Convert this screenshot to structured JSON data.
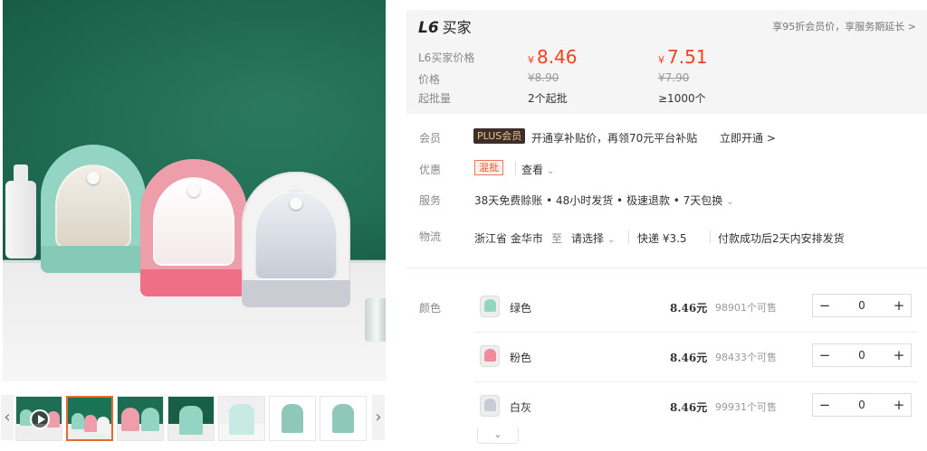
{
  "gallery": {
    "prev_arrow": "‹",
    "next_arrow": "›",
    "thumbnails": [
      {
        "kind": "video",
        "active": false
      },
      {
        "kind": "image",
        "active": true
      },
      {
        "kind": "image",
        "active": false
      },
      {
        "kind": "image",
        "active": false
      },
      {
        "kind": "image",
        "active": false
      },
      {
        "kind": "image",
        "active": false
      },
      {
        "kind": "image",
        "active": false
      }
    ]
  },
  "price_panel": {
    "tier_badge": "L6",
    "tier_title": "买家",
    "member_note": "享95折会员价，享服务期延长 > ",
    "price_label": "L6买家价格",
    "orig_label": "价格",
    "moq_label": "起批量",
    "currency": "¥",
    "tiers": [
      {
        "price": "8.46",
        "orig": "¥8.90",
        "moq": "2个起批"
      },
      {
        "price": "7.51",
        "orig": "¥7.90",
        "moq": "≥1000个"
      }
    ],
    "colors": {
      "price": "#ff3f1a",
      "panel_bg": "#f5f5f5"
    }
  },
  "member": {
    "label": "会员",
    "badge": "PLUS会员",
    "text": "开通享补贴价，再领70元平台补贴",
    "action": "立即开通 >"
  },
  "promo": {
    "label": "优惠",
    "tag": "混批",
    "action": "查看"
  },
  "service": {
    "label": "服务",
    "text": "38天免费赊账 • 48小时发货 • 极速退款 • 7天包换"
  },
  "logistics": {
    "label": "物流",
    "origin": "浙江省 金华市",
    "to": "至",
    "dest_select": "请选择",
    "shipping": "快递 ¥3.5",
    "dispatch": "付款成功后2天内安排发货"
  },
  "sku": {
    "label": "颜色",
    "items": [
      {
        "name": "绿色",
        "price": "8.46元",
        "stock": "98901个可售",
        "qty": "0",
        "swatch": "#93d4c3"
      },
      {
        "name": "粉色",
        "price": "8.46元",
        "stock": "98433个可售",
        "qty": "0",
        "swatch": "#ee8c9c"
      },
      {
        "name": "白灰",
        "price": "8.46元",
        "stock": "99931个可售",
        "qty": "0",
        "swatch": "#c9ccd3"
      }
    ],
    "minus": "−",
    "plus": "+",
    "expand": "⌄"
  }
}
